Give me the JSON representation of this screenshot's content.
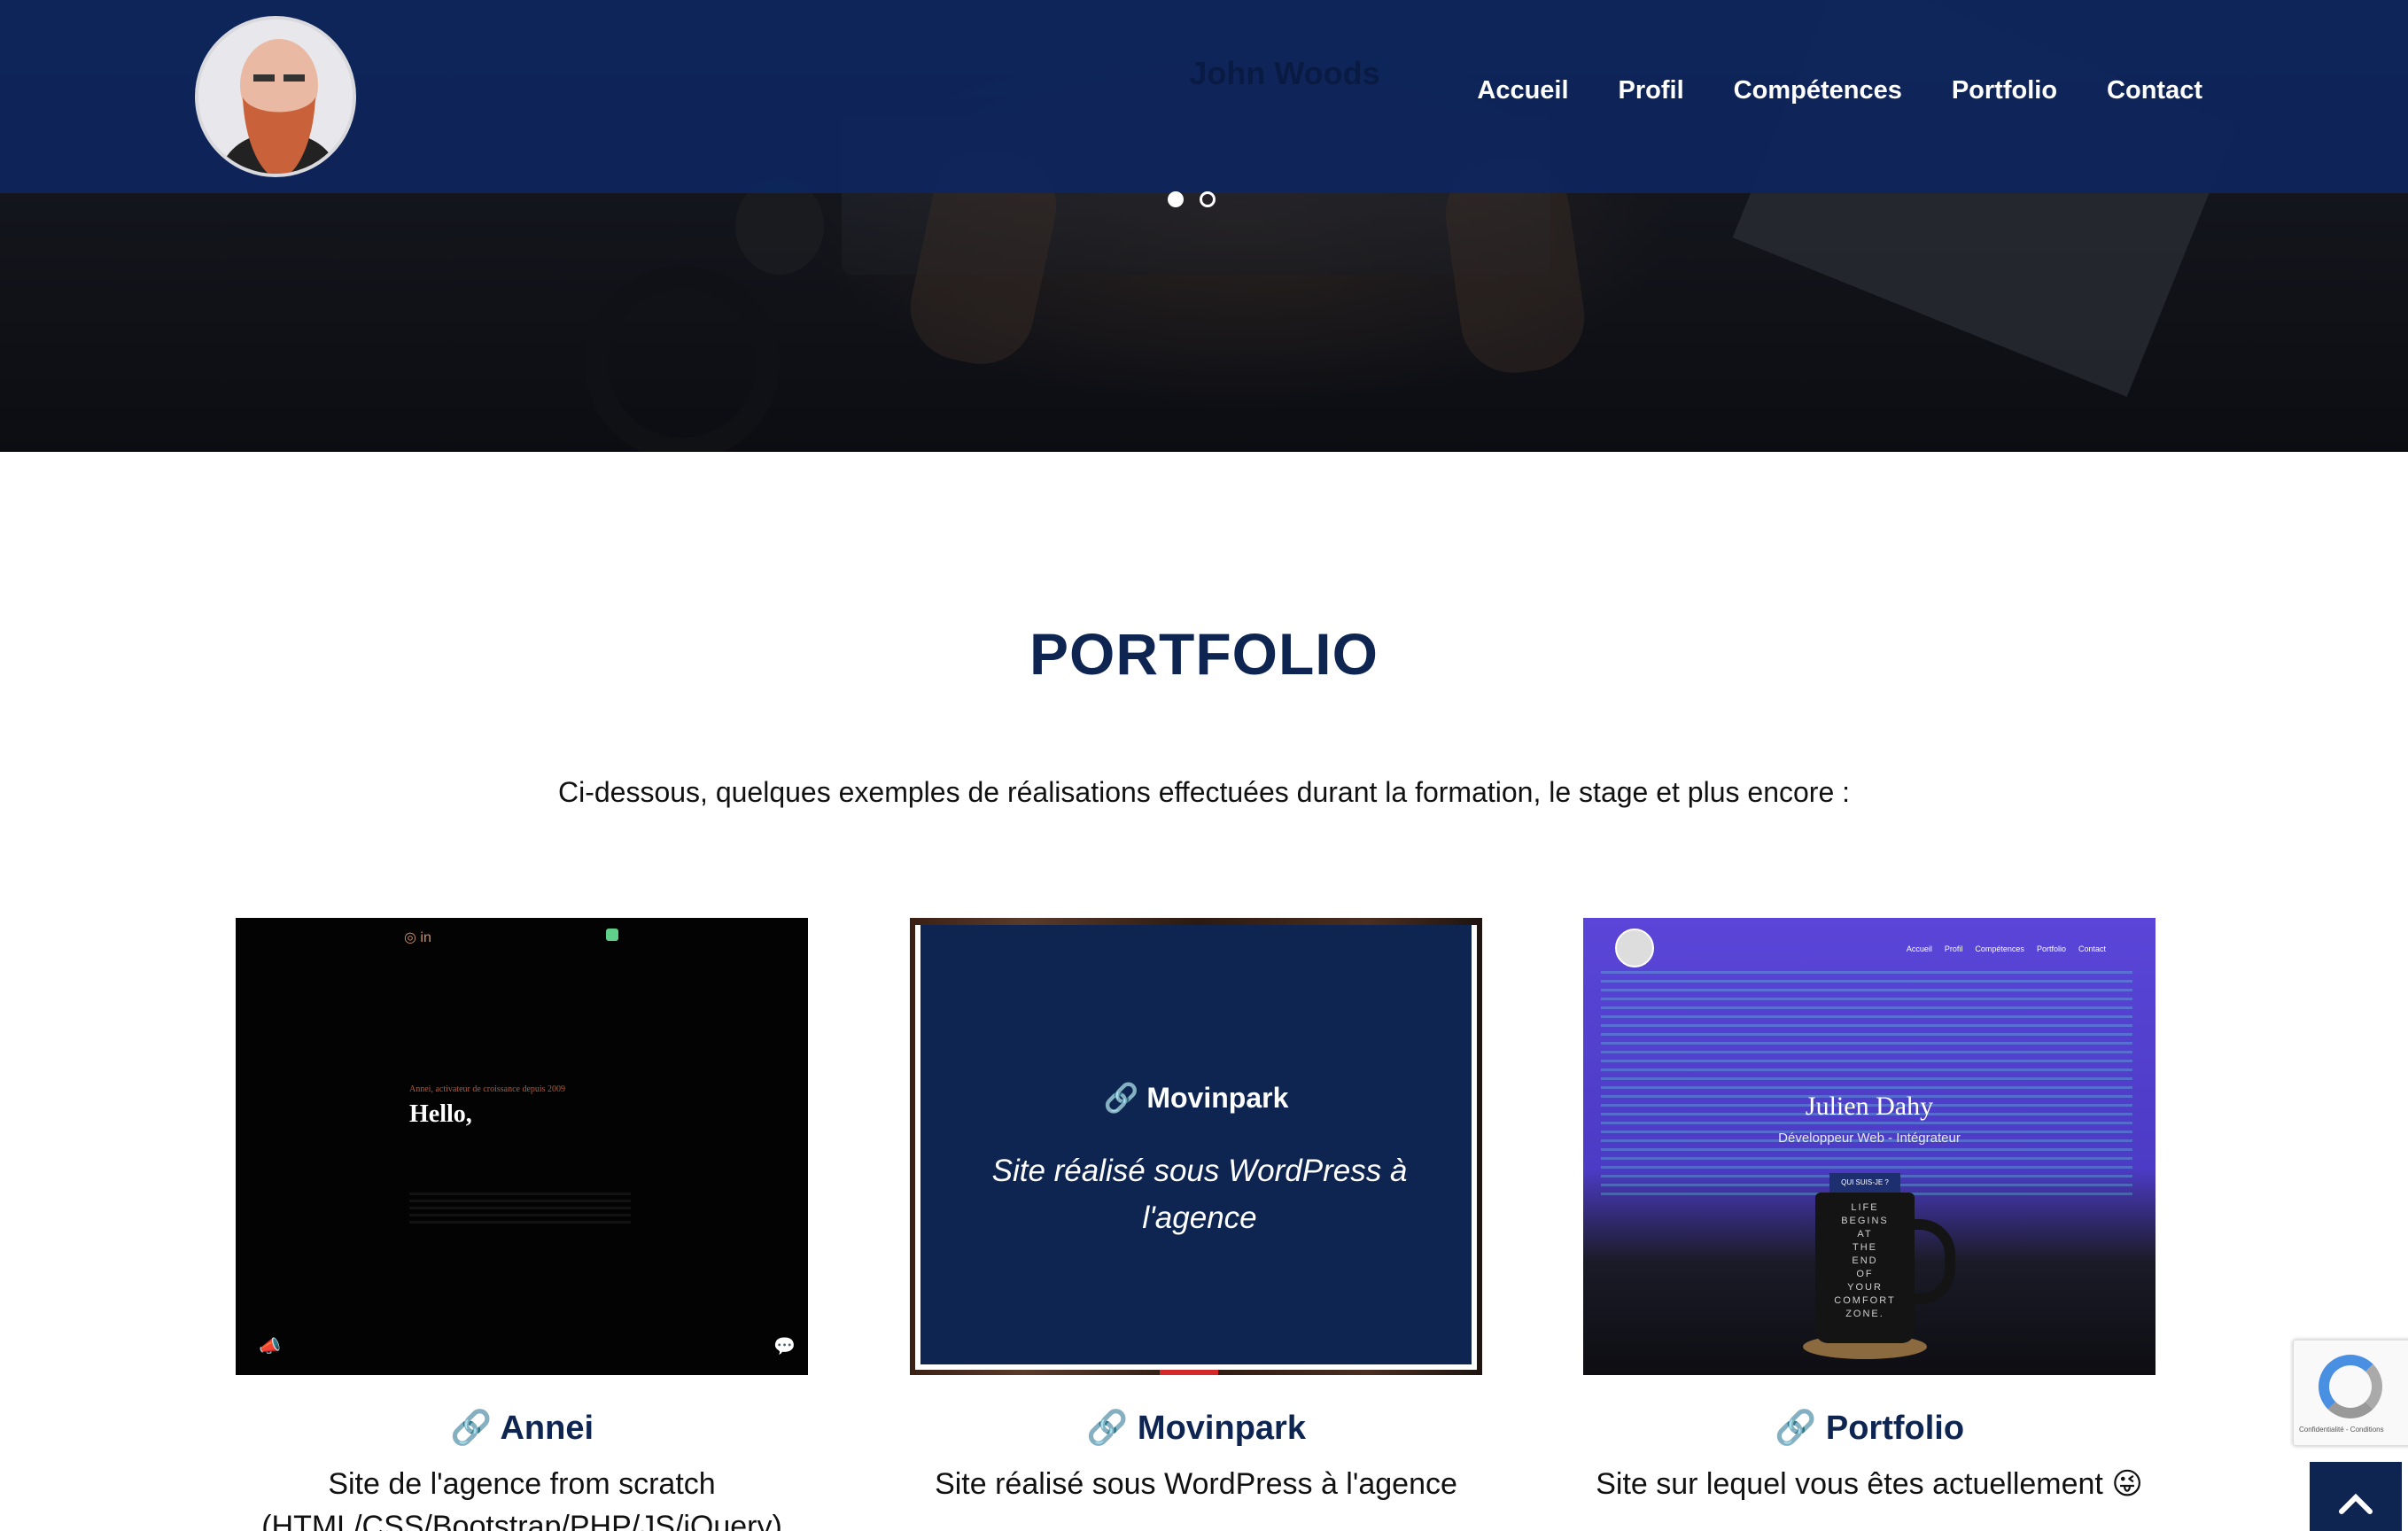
{
  "header": {
    "ghost_name": "John Woods",
    "nav": [
      "Accueil",
      "Profil",
      "Compétences",
      "Portfolio",
      "Contact"
    ]
  },
  "slider": {
    "dots": 2,
    "active_index": 0
  },
  "portfolio": {
    "title": "PORTFOLIO",
    "intro": "Ci-dessous, quelques exemples de réalisations effectuées durant la formation, le stage et plus encore :",
    "projects": [
      {
        "link_icon": "🔗",
        "title": "Annei",
        "desc": "Site de l'agence from scratch",
        "desc_line2": "(HTML/CSS/Bootstrap/PHP/JS/jQuery)",
        "thumb": {
          "small": "Annei, activateur de croissance depuis 2009",
          "hello": "Hello,"
        }
      },
      {
        "link_icon": "🔗",
        "title": "Movinpark",
        "desc": "Site réalisé sous WordPress à l'agence",
        "overlay_title": "Movinpark",
        "overlay_desc": "Site réalisé sous WordPress à l'agence"
      },
      {
        "link_icon": "🔗",
        "title": "Portfolio",
        "desc": "Site sur lequel vous êtes actuellement 😜",
        "thumb": {
          "name": "Julien Dahy",
          "role": "Développeur Web - Intégrateur",
          "badge": "QUI SUIS-JE ?",
          "mug": "LIFE\nBEGINS\nAT\nTHE\nEND\nOF\nYOUR\nCOMFORT\nZONE.",
          "mini_nav": [
            "Accueil",
            "Profil",
            "Compétences",
            "Portfolio",
            "Contact"
          ]
        }
      }
    ]
  },
  "recaptcha": {
    "text": "Confidentialité - Conditions"
  },
  "scroll_top": {
    "icon": "chevron-up-icon"
  },
  "colors": {
    "navy": "#0e2552",
    "accent_red": "#d4282a"
  }
}
